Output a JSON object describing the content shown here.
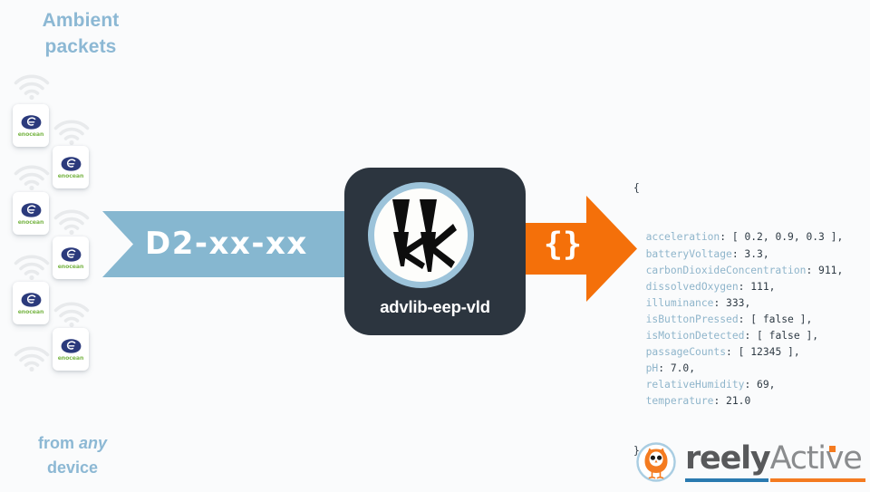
{
  "page": {
    "background_color": "#fafbfc"
  },
  "left_panel": {
    "heading_line1": "Ambient",
    "heading_line2": "packets",
    "heading_color": "#8cb8d4",
    "footnote_prefix": "from ",
    "footnote_emphasis": "any",
    "footnote_line2": "device",
    "device_brand": "enocean",
    "device_count": 6,
    "signal_icon": "wifi-icon"
  },
  "input_banner": {
    "label": "D2-xx-xx",
    "color": "#86b7d0",
    "text_color": "#ffffff"
  },
  "module": {
    "name": "advlib-eep-vld",
    "tile_color": "#2c353f",
    "ring_color": "#9cc3da",
    "glyph_name": "advlib-logo-glyph"
  },
  "output_arrow": {
    "label": "{}",
    "color": "#f4700a",
    "text_color": "#ffffff"
  },
  "json_output": {
    "open_brace": "{",
    "close_brace": "}",
    "key_color": "#8fb5cb",
    "value_color": "#2e3a44",
    "entries": [
      {
        "key": "acceleration",
        "value": "[ 0.2, 0.9, 0.3 ]",
        "comma": ","
      },
      {
        "key": "batteryVoltage",
        "value": "3.3",
        "comma": ","
      },
      {
        "key": "carbonDioxideConcentration",
        "value": "911",
        "comma": ","
      },
      {
        "key": "dissolvedOxygen",
        "value": "111",
        "comma": ","
      },
      {
        "key": "illuminance",
        "value": "333",
        "comma": ","
      },
      {
        "key": "isButtonPressed",
        "value": "[ false ]",
        "comma": ","
      },
      {
        "key": "isMotionDetected",
        "value": "[ false ]",
        "comma": ","
      },
      {
        "key": "passageCounts",
        "value": "[ 12345 ]",
        "comma": ","
      },
      {
        "key": "pH",
        "value": "7.0",
        "comma": ","
      },
      {
        "key": "relativeHumidity",
        "value": "69",
        "comma": ","
      },
      {
        "key": "temperature",
        "value": "21.0",
        "comma": ""
      }
    ]
  },
  "brand_logo": {
    "word_part1": "reely",
    "word_part2": "Active",
    "part1_color": "#58595b",
    "part2_color": "#8a8c8e",
    "underline_blue": "#2a7ab0",
    "underline_orange": "#f47b20",
    "owl_icon": "owl-icon",
    "owl_color": "#f47b20",
    "owl_circle_color": "#a9cde2"
  }
}
